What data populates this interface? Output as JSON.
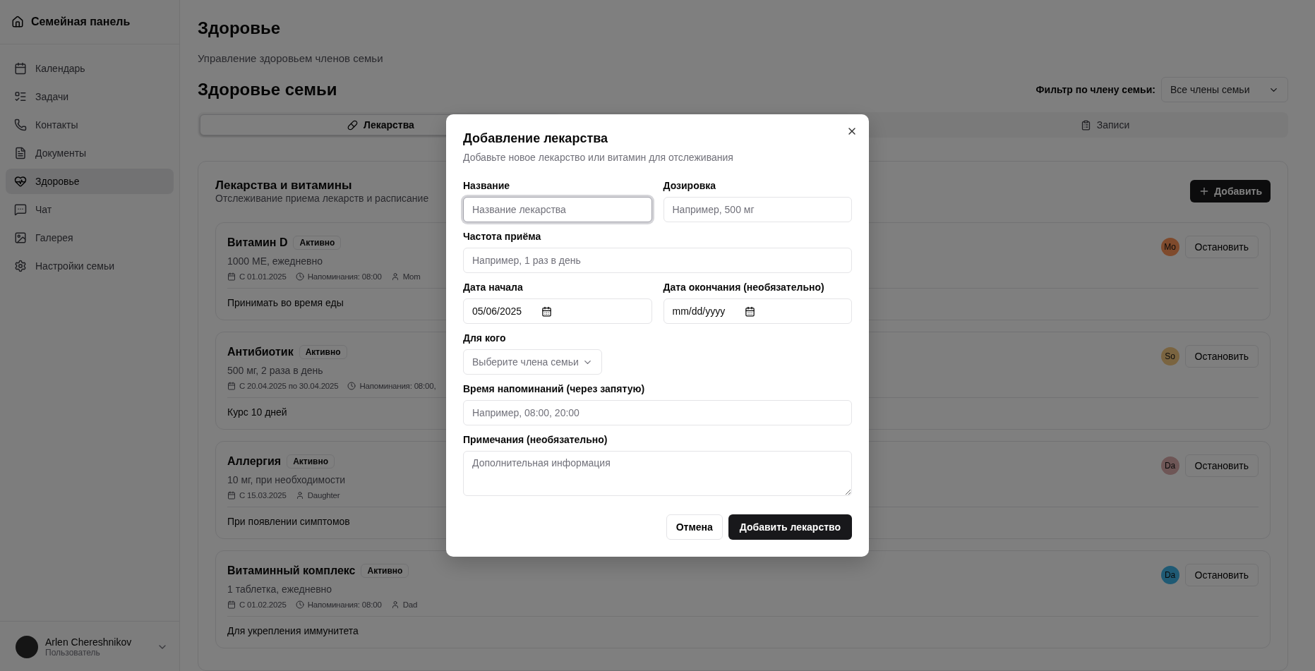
{
  "sidebar": {
    "brand": "Семейная панель",
    "items": [
      {
        "label": "Календарь",
        "selected": false
      },
      {
        "label": "Задачи",
        "selected": false
      },
      {
        "label": "Контакты",
        "selected": false
      },
      {
        "label": "Документы",
        "selected": false
      },
      {
        "label": "Здоровье",
        "selected": true
      },
      {
        "label": "Чат",
        "selected": false
      },
      {
        "label": "Галерея",
        "selected": false
      },
      {
        "label": "Настройки семьи",
        "selected": false
      }
    ],
    "user": {
      "name": "Arlen Chereshnikov",
      "role": "Пользователь"
    }
  },
  "page": {
    "title": "Здоровье",
    "subtitle": "Управление здоровьем членов семьи",
    "section_title": "Здоровье семьи",
    "filter": {
      "label": "Фильтр по члену семьи:",
      "value": "Все члены семьи"
    }
  },
  "tabs": [
    {
      "label": "Лекарства",
      "selected": true
    },
    {
      "label": "Записи",
      "selected": false
    }
  ],
  "medications_panel": {
    "title": "Лекарства и витамины",
    "subtitle": "Отслеживание приема лекарств и расписание",
    "add_button": "Добавить",
    "items": [
      {
        "name": "Витамин D",
        "status": "Активно",
        "dose": "1000 МЕ, ежедневно",
        "meta": [
          {
            "kind": "date",
            "text": "С 01.01.2025"
          },
          {
            "kind": "reminder",
            "text": "Напоминания: 08:00"
          },
          {
            "kind": "person",
            "text": "Mom"
          }
        ],
        "note": "Принимать во время еды",
        "initials": "Mo",
        "color": "#8a4a2c",
        "action": "Остановить"
      },
      {
        "name": "Антибиотик",
        "status": "Активно",
        "dose": "500 мг, 2 раза в день",
        "meta": [
          {
            "kind": "date",
            "text": "С 20.04.2025 по 30.04.2025"
          },
          {
            "kind": "reminder",
            "text": "Напоминания: 08:00,"
          }
        ],
        "note": "Курс 10 дней",
        "initials": "So",
        "color": "#7a6440",
        "action": "Остановить"
      },
      {
        "name": "Аллергия",
        "status": "Активно",
        "dose": "10 мг, при необходимости",
        "meta": [
          {
            "kind": "date",
            "text": "С 15.03.2025"
          },
          {
            "kind": "person",
            "text": "Daughter"
          }
        ],
        "note": "При появлении симптомов",
        "initials": "Da",
        "color": "#6e5656",
        "action": "Остановить"
      },
      {
        "name": "Витаминный комплекс",
        "status": "Активно",
        "dose": "1 таблетка, ежедневно",
        "meta": [
          {
            "kind": "date",
            "text": "С 01.02.2025"
          },
          {
            "kind": "reminder",
            "text": "Напоминания: 08:00"
          },
          {
            "kind": "person",
            "text": "Dad"
          }
        ],
        "note": "Для укрепления иммунитета",
        "initials": "Da",
        "color": "#1f5a74",
        "action": "Остановить"
      }
    ]
  },
  "dialog": {
    "title": "Добавление лекарства",
    "description": "Добавьте новое лекарство или витамин для отслеживания",
    "rows": [
      [
        {
          "kind": "text",
          "label": "Название",
          "placeholder": "Название лекарства",
          "focused": true
        },
        {
          "kind": "text",
          "label": "Дозировка",
          "placeholder": "Например, 500 мг",
          "focused": false
        }
      ],
      [
        {
          "kind": "text",
          "label": "Частота приёма",
          "placeholder": "Например, 1 раз в день",
          "focused": false
        }
      ],
      [
        {
          "kind": "date",
          "label": "Дата начала",
          "value": "05/06/2025"
        },
        {
          "kind": "date",
          "label": "Дата окончания (необязательно)",
          "value": "mm/dd/yyyy"
        }
      ],
      [
        {
          "kind": "select",
          "label": "Для кого",
          "placeholder": "Выберите члена семьи"
        }
      ],
      [
        {
          "kind": "text",
          "label": "Время напоминаний (через запятую)",
          "placeholder": "Например, 08:00, 20:00",
          "focused": false
        }
      ],
      [
        {
          "kind": "textarea",
          "label": "Примечания (необязательно)",
          "placeholder": "Дополнительная информация"
        }
      ]
    ],
    "cancel": "Отмена",
    "submit": "Добавить лекарство"
  }
}
